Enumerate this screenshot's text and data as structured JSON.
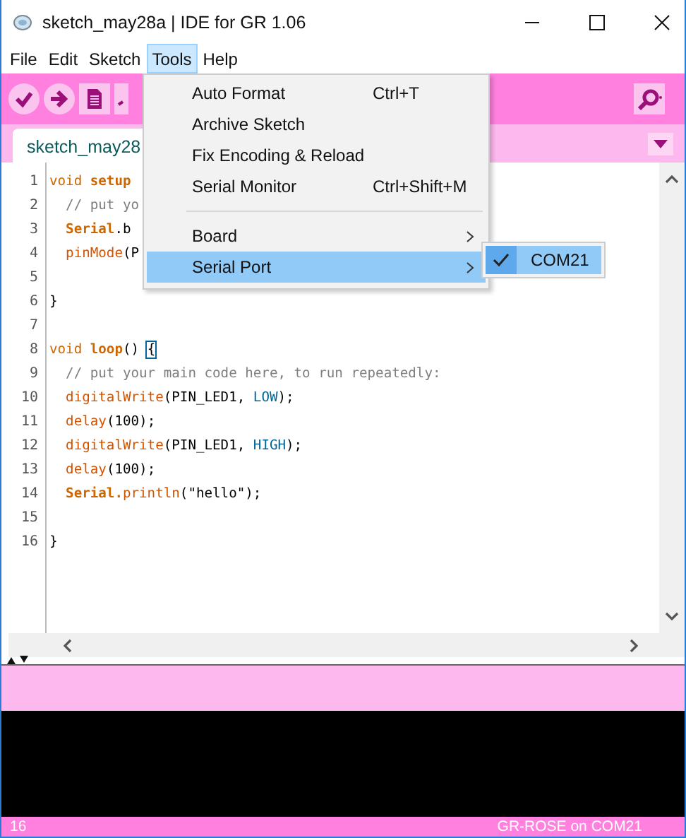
{
  "window": {
    "title": "sketch_may28a | IDE for GR 1.06"
  },
  "menu_bar": [
    {
      "label": "File",
      "selected": false
    },
    {
      "label": "Edit",
      "selected": false
    },
    {
      "label": "Sketch",
      "selected": false
    },
    {
      "label": "Tools",
      "selected": true
    },
    {
      "label": "Help",
      "selected": false
    }
  ],
  "tools_menu": {
    "items": [
      {
        "kind": "item",
        "label": "Auto Format",
        "shortcut": "Ctrl+T",
        "selected": false
      },
      {
        "kind": "item",
        "label": "Archive Sketch",
        "selected": false
      },
      {
        "kind": "item",
        "label": "Fix Encoding & Reload",
        "selected": false
      },
      {
        "kind": "item",
        "label": "Serial Monitor",
        "shortcut": "Ctrl+Shift+M",
        "selected": false
      },
      {
        "kind": "separator"
      },
      {
        "kind": "submenu",
        "label": "Board",
        "selected": false
      },
      {
        "kind": "submenu",
        "label": "Serial Port",
        "selected": true
      }
    ],
    "submenu": [
      {
        "label": "COM21",
        "checked": true,
        "selected": true
      }
    ]
  },
  "tab": {
    "label": "sketch_may28"
  },
  "code_lines": [
    {
      "number": "1",
      "tokens": [
        {
          "text": "void",
          "kind": "keyword"
        },
        {
          "text": " setup",
          "kind": "bold"
        }
      ]
    },
    {
      "number": "2",
      "tokens": [
        {
          "text": "  // put yo",
          "kind": "comment"
        }
      ]
    },
    {
      "number": "3",
      "tokens": [
        {
          "text": "  Serial",
          "kind": "bold"
        },
        {
          "text": ".b",
          "kind": "plain"
        }
      ]
    },
    {
      "number": "4",
      "tokens": [
        {
          "text": "  pinMode",
          "kind": "function"
        },
        {
          "text": "(P",
          "kind": "plain"
        }
      ]
    },
    {
      "number": "5"
    },
    {
      "number": "6",
      "tokens": [
        {
          "text": "}",
          "kind": "plain"
        }
      ]
    },
    {
      "number": "7"
    },
    {
      "number": "8",
      "tokens": [
        {
          "text": "void",
          "kind": "keyword"
        },
        {
          "text": " loop",
          "kind": "bold"
        },
        {
          "text": "() ",
          "kind": "plain"
        },
        {
          "text": "{",
          "kind": "bracket"
        }
      ]
    },
    {
      "number": "9",
      "tokens": [
        {
          "text": "  // put your main code here, to run repeatedly:",
          "kind": "comment"
        }
      ]
    },
    {
      "number": "10",
      "tokens": [
        {
          "text": "  digitalWrite",
          "kind": "function"
        },
        {
          "text": "(PIN_LED1, ",
          "kind": "plain"
        },
        {
          "text": "LOW",
          "kind": "constant"
        },
        {
          "text": ");",
          "kind": "plain"
        }
      ]
    },
    {
      "number": "11",
      "tokens": [
        {
          "text": "  delay",
          "kind": "function"
        },
        {
          "text": "(100);",
          "kind": "plain"
        }
      ]
    },
    {
      "number": "12",
      "tokens": [
        {
          "text": "  digitalWrite",
          "kind": "function"
        },
        {
          "text": "(PIN_LED1, ",
          "kind": "plain"
        },
        {
          "text": "HIGH",
          "kind": "constant"
        },
        {
          "text": ");",
          "kind": "plain"
        }
      ]
    },
    {
      "number": "13",
      "tokens": [
        {
          "text": "  delay",
          "kind": "function"
        },
        {
          "text": "(100);",
          "kind": "plain"
        }
      ]
    },
    {
      "number": "14",
      "tokens": [
        {
          "text": "  Serial.",
          "kind": "bold"
        },
        {
          "text": "println",
          "kind": "function"
        },
        {
          "text": "(\"hello\");",
          "kind": "plain"
        }
      ]
    },
    {
      "number": "15"
    },
    {
      "number": "16",
      "tokens": [
        {
          "text": "}",
          "kind": "plain"
        }
      ]
    }
  ],
  "status_bar": {
    "line": "16",
    "board": "GR-ROSE on COM21"
  }
}
